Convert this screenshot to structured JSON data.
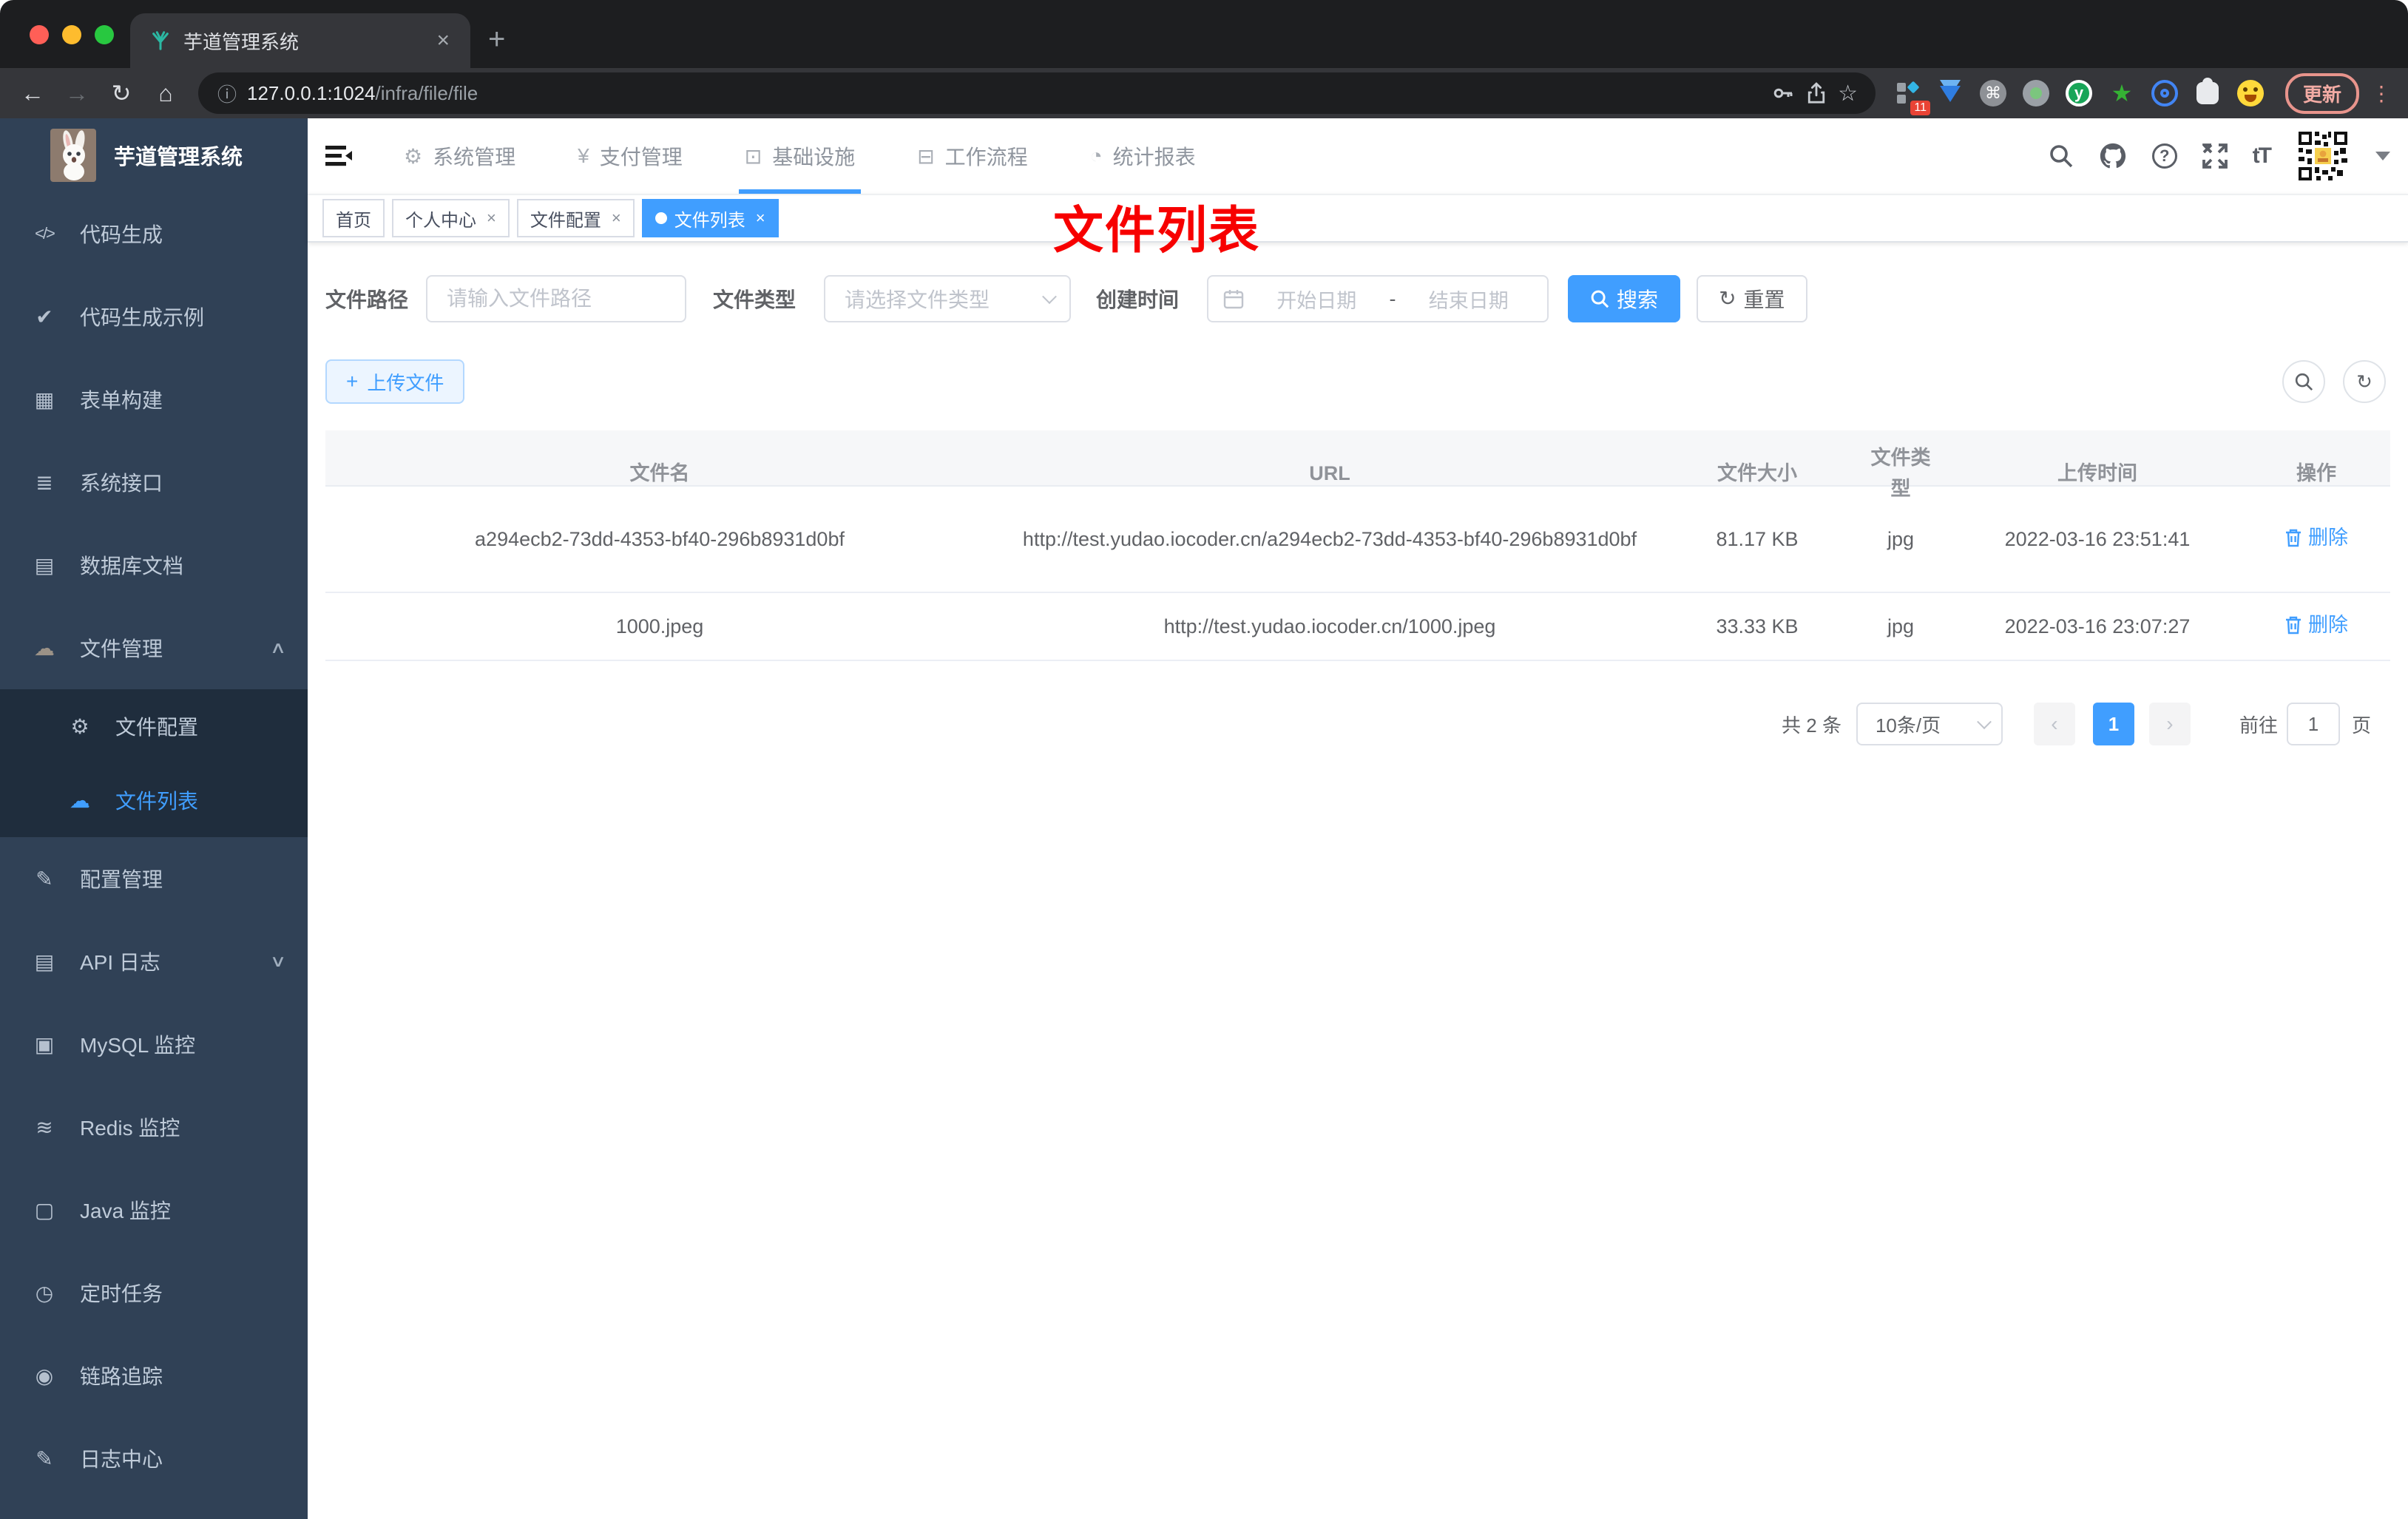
{
  "browser": {
    "tab_title": "芋道管理系统",
    "url_host": "127.0.0.1:1024",
    "url_path": "/infra/file/file",
    "update_label": "更新",
    "extension_badge": "11"
  },
  "glyphs": {
    "close": "×",
    "plus": "+",
    "back": "←",
    "forward": "→",
    "reload": "↻",
    "home": "⌂",
    "info": "ⓘ",
    "star": "☆",
    "cmd": "⌘",
    "kebab": "⋮",
    "ext_y": "y",
    "ext_star": "★",
    "code": "</>",
    "shield": "✔",
    "grid": "▦",
    "sliders": "≣",
    "table": "▤",
    "cloud_down": "☁",
    "gear": "⚙",
    "cloud_up": "☁",
    "edit": "✎",
    "doc": "▤",
    "monitor": "▣",
    "layers": "≋",
    "screen": "▢",
    "clock": "◷",
    "eye": "◉",
    "pencil": "✎",
    "yen": "¥",
    "infra": "⊡",
    "briefcase": "⊟",
    "gauge": "◔",
    "caret_up": "∧",
    "caret_down": "∨",
    "help": "?",
    "font_size": "tT",
    "refresh": "↻",
    "prev": "‹",
    "next": "›"
  },
  "app_header": {
    "menus": [
      {
        "label": "系统管理"
      },
      {
        "label": "支付管理"
      },
      {
        "label": "基础设施"
      },
      {
        "label": "工作流程"
      },
      {
        "label": "统计报表"
      }
    ]
  },
  "sidebar": {
    "logo_title": "芋道管理系统",
    "items": [
      {
        "label": "代码生成"
      },
      {
        "label": "代码生成示例"
      },
      {
        "label": "表单构建"
      },
      {
        "label": "系统接口"
      },
      {
        "label": "数据库文档"
      },
      {
        "label": "文件管理",
        "children": [
          {
            "label": "文件配置"
          },
          {
            "label": "文件列表"
          }
        ]
      },
      {
        "label": "配置管理"
      },
      {
        "label": "API 日志"
      },
      {
        "label": "MySQL 监控"
      },
      {
        "label": "Redis 监控"
      },
      {
        "label": "Java 监控"
      },
      {
        "label": "定时任务"
      },
      {
        "label": "链路追踪"
      },
      {
        "label": "日志中心"
      }
    ]
  },
  "tags": [
    {
      "label": "首页"
    },
    {
      "label": "个人中心"
    },
    {
      "label": "文件配置"
    },
    {
      "label": "文件列表"
    }
  ],
  "annotation": "文件列表",
  "filter": {
    "path_label": "文件路径",
    "path_placeholder": "请输入文件路径",
    "type_label": "文件类型",
    "type_placeholder": "请选择文件类型",
    "date_label": "创建时间",
    "date_start": "开始日期",
    "date_separator": "-",
    "date_end": "结束日期",
    "search_label": "搜索",
    "reset_label": "重置"
  },
  "toolbar": {
    "upload_label": "上传文件"
  },
  "table": {
    "headers": [
      "文件名",
      "URL",
      "文件大小",
      "文件类型",
      "上传时间",
      "操作"
    ],
    "rows": [
      {
        "name": "a294ecb2-73dd-4353-bf40-296b8931d0bf",
        "url": "http://test.yudao.iocoder.cn/a294ecb2-73dd-4353-bf40-296b8931d0bf",
        "size": "81.17 KB",
        "type": "jpg",
        "time": "2022-03-16 23:51:41",
        "action": "删除"
      },
      {
        "name": "1000.jpeg",
        "url": "http://test.yudao.iocoder.cn/1000.jpeg",
        "size": "33.33 KB",
        "type": "jpg",
        "time": "2022-03-16 23:07:27",
        "action": "删除"
      }
    ]
  },
  "pagination": {
    "total": "共 2 条",
    "page_size": "10条/页",
    "current_page": "1",
    "goto_label": "前往",
    "goto_value": "1",
    "page_unit": "页"
  },
  "colors": {
    "accent": "#409eff",
    "annotation_red": "#f70000",
    "sidebar_bg": "#304156",
    "submenu_bg": "#1f2d3d"
  }
}
